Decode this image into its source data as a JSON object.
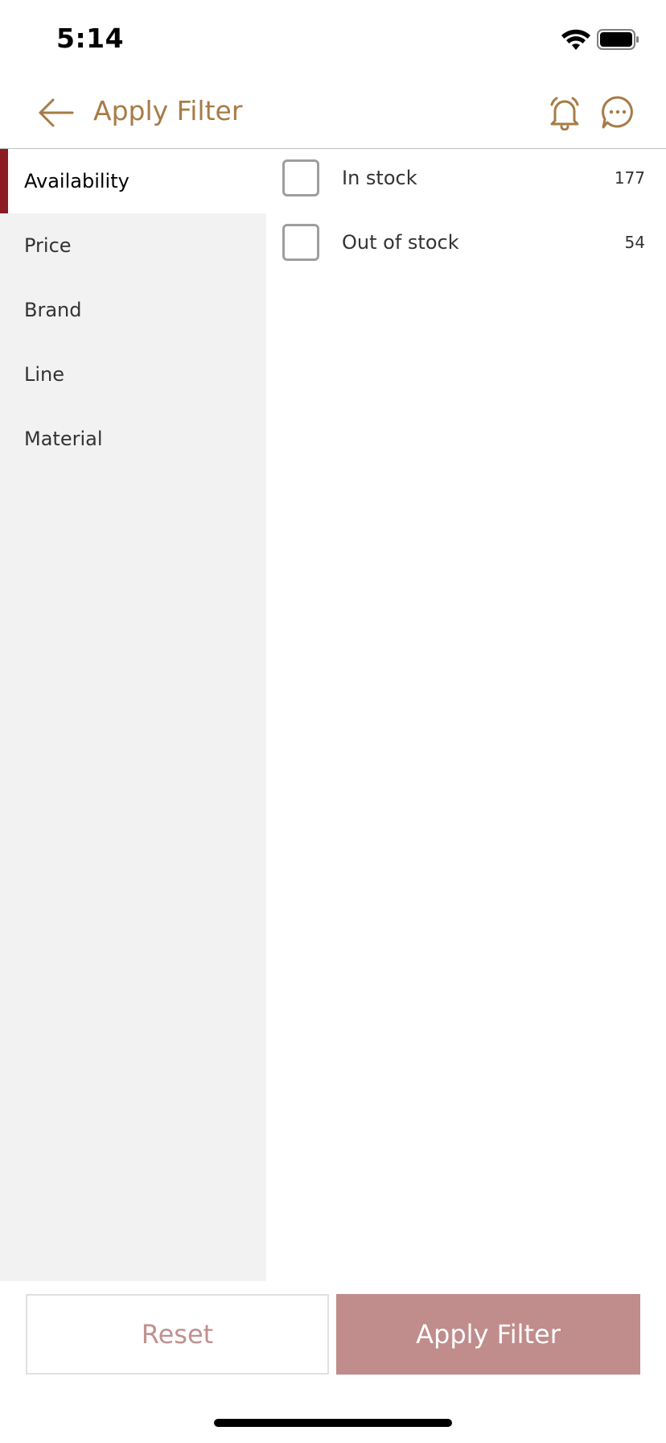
{
  "status_bar": {
    "time": "5:14",
    "wifi_icon": "wifi-icon",
    "battery_icon": "battery-icon"
  },
  "header": {
    "title": "Apply Filter",
    "back_icon": "arrow-left-icon",
    "bell_icon": "bell-icon",
    "chat_icon": "chat-bubble-icon"
  },
  "sidebar": {
    "items": [
      {
        "label": "Availability",
        "active": true
      },
      {
        "label": "Price",
        "active": false
      },
      {
        "label": "Brand",
        "active": false
      },
      {
        "label": "Line",
        "active": false
      },
      {
        "label": "Material",
        "active": false
      }
    ]
  },
  "options": [
    {
      "label": "In stock",
      "count": "177",
      "checked": false
    },
    {
      "label": "Out of stock",
      "count": "54",
      "checked": false
    }
  ],
  "footer": {
    "reset_label": "Reset",
    "apply_label": "Apply Filter"
  },
  "colors": {
    "accent": "#a77b47",
    "active_marker": "#8c1c22",
    "apply_button": "#c08c8c",
    "reset_text": "#c19090"
  }
}
